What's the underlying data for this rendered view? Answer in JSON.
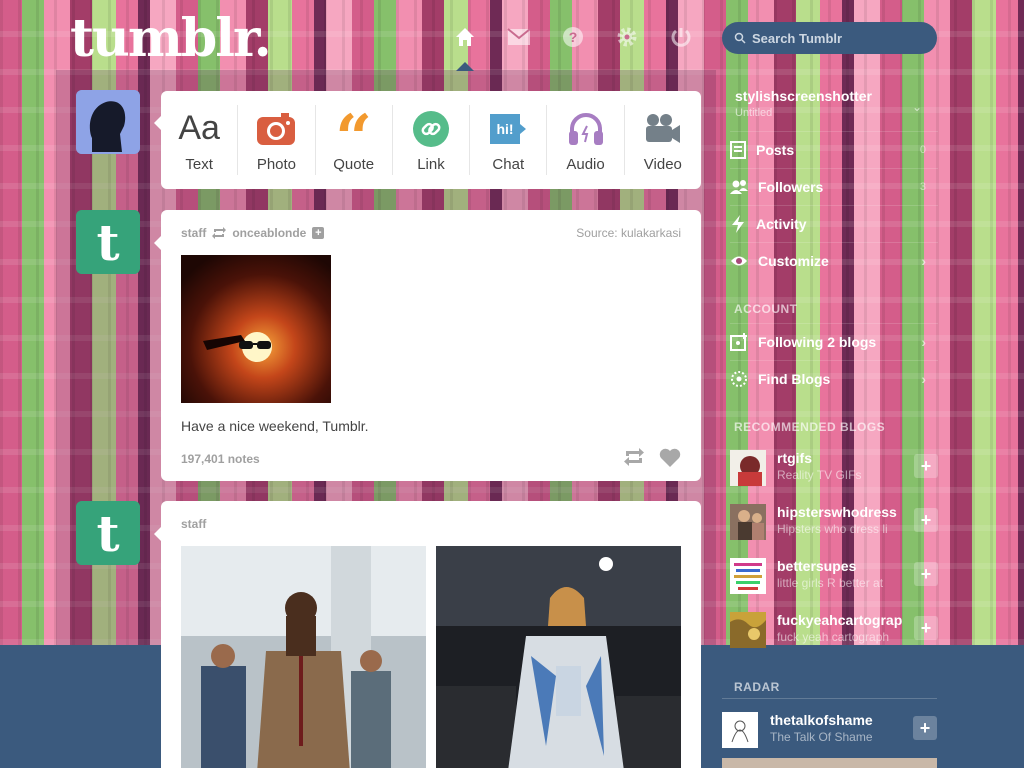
{
  "header": {
    "logo": "tumblr.",
    "search_placeholder": "Search Tumblr",
    "nav": [
      "home-icon",
      "mail-icon",
      "help-icon",
      "gear-icon",
      "power-icon"
    ]
  },
  "post_types": [
    {
      "label": "Text",
      "icon": "text-icon",
      "color": "#444444"
    },
    {
      "label": "Photo",
      "icon": "camera-icon",
      "color": "#d95e40"
    },
    {
      "label": "Quote",
      "icon": "quote-icon",
      "color": "#f2992e"
    },
    {
      "label": "Link",
      "icon": "link-icon",
      "color": "#56bc8a"
    },
    {
      "label": "Chat",
      "icon": "chat-icon",
      "color": "#529ecc"
    },
    {
      "label": "Audio",
      "icon": "headphones-icon",
      "color": "#a77dc2"
    },
    {
      "label": "Video",
      "icon": "video-camera-icon",
      "color": "#748089"
    }
  ],
  "posts": [
    {
      "author": "staff",
      "reblogged_from": "onceablonde",
      "source": "Source: kulakarkasi",
      "caption": "Have a nice weekend, Tumblr.",
      "notes": "197,401 notes"
    },
    {
      "author": "staff"
    }
  ],
  "sidebar": {
    "blog_name": "stylishscreenshotter",
    "blog_subtitle": "Untitled",
    "items": [
      {
        "label": "Posts",
        "count": "0",
        "icon": "posts-icon"
      },
      {
        "label": "Followers",
        "count": "3",
        "icon": "followers-icon"
      },
      {
        "label": "Activity",
        "icon": "activity-icon"
      },
      {
        "label": "Customize",
        "icon": "eye-icon"
      }
    ],
    "account_heading": "ACCOUNT",
    "account_items": [
      {
        "label": "Following 2 blogs",
        "icon": "following-icon"
      },
      {
        "label": "Find Blogs",
        "icon": "find-blogs-icon"
      }
    ],
    "recommended_heading": "RECOMMENDED BLOGS",
    "recommended": [
      {
        "name": "rtgifs",
        "desc": "Reality TV GIFs"
      },
      {
        "name": "hipsterswhodress",
        "desc": "Hipsters who dress li"
      },
      {
        "name": "bettersupes",
        "desc": "little girls R better at"
      },
      {
        "name": "fuckyeahcartograph",
        "desc": "fuck yeah cartograph"
      }
    ],
    "radar_heading": "RADAR",
    "radar": {
      "name": "thetalkofshame",
      "desc": "The Talk Of Shame"
    }
  },
  "colors": {
    "header_bg": "#3b5a7e",
    "card_bg": "#ffffff",
    "muted_text": "#a0a0a0"
  }
}
